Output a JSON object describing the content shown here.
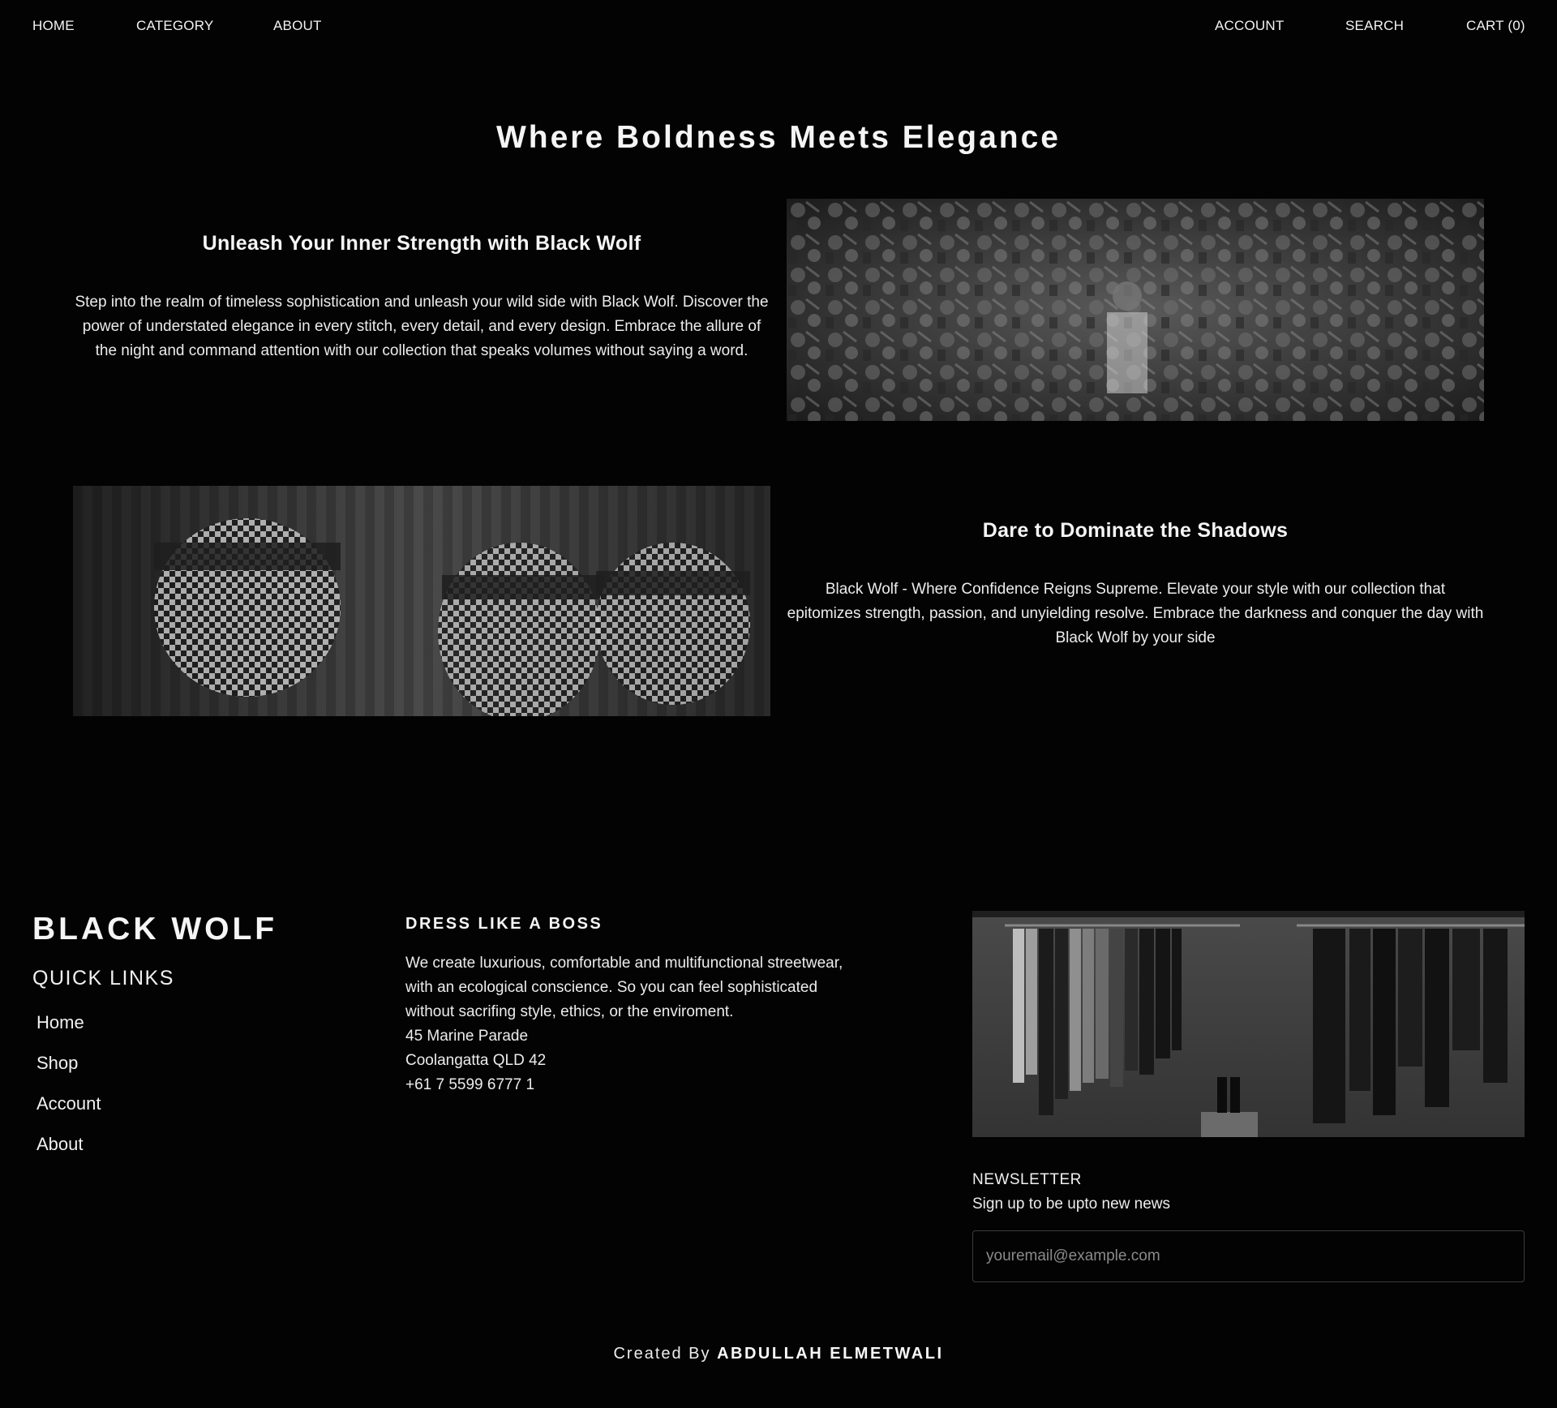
{
  "nav": {
    "home": "HOME",
    "category": "CATEGORY",
    "about": "ABOUT",
    "account": "ACCOUNT",
    "search": "SEARCH",
    "cart": "CART (0)"
  },
  "hero": {
    "title": "Where Boldness Meets Elegance"
  },
  "sections": [
    {
      "heading": "Unleash Your Inner Strength with Black Wolf",
      "body": "Step into the realm of timeless sophistication and unleash your wild side with Black Wolf. Discover the power of understated elegance in every stitch, every detail, and every design. Embrace the allure of the night and command attention with our collection that speaks volumes without saying a word."
    },
    {
      "heading": "Dare to Dominate the Shadows",
      "body": "Black Wolf - Where Confidence Reigns Supreme. Elevate your style with our collection that epitomizes strength, passion, and unyielding resolve. Embrace the darkness and conquer the day with Black Wolf by your side"
    }
  ],
  "footer": {
    "brand": "BLACK WOLF",
    "quick_links_title": "QUICK LINKS",
    "quick_links": [
      "Home",
      "Shop",
      "Account",
      "About"
    ],
    "dress_title": "DRESS LIKE A BOSS",
    "dress_text": "We create luxurious, comfortable and multifunctional streetwear, with an ecological conscience. So you can feel sophisticated without sacrifing style, ethics, or the enviroment.",
    "address_line1": "45 Marine Parade",
    "address_line2": "Coolangatta QLD 42",
    "phone": "+61 7 5599 6777 1",
    "newsletter_title": "NEWSLETTER",
    "newsletter_sub": "Sign up to be upto new news",
    "newsletter_placeholder": "youremail@example.com",
    "credit_prefix": "Created By",
    "credit_name": "ABDULLAH ELMETWALI"
  }
}
